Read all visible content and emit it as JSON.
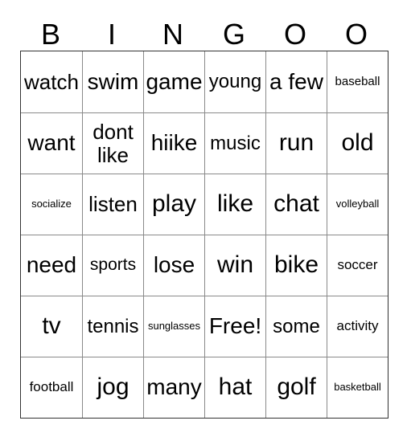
{
  "card": {
    "header_letters": [
      "B",
      "I",
      "N",
      "G",
      "O",
      "O"
    ],
    "columns": 6,
    "rows": 6,
    "colors": {
      "background": "#ffffff",
      "text": "#000000",
      "grid_line": "#8a8a8a",
      "outer_border": "#333333"
    },
    "cells": [
      [
        {
          "text": "watch",
          "size": "fs-l"
        },
        {
          "text": "swim",
          "size": "fs-xl"
        },
        {
          "text": "game",
          "size": "fs-xl"
        },
        {
          "text": "young",
          "size": "fs-ml"
        },
        {
          "text": "a few",
          "size": "fs-xl"
        },
        {
          "text": "baseball",
          "size": "fs-s"
        }
      ],
      [
        {
          "text": "want",
          "size": "fs-xl"
        },
        {
          "text": "dont like",
          "size": "fs-l"
        },
        {
          "text": "hiike",
          "size": "fs-xl"
        },
        {
          "text": "music",
          "size": "fs-ml"
        },
        {
          "text": "run",
          "size": "fs-xxl"
        },
        {
          "text": "old",
          "size": "fs-xxl"
        }
      ],
      [
        {
          "text": "socialize",
          "size": "fs-xs"
        },
        {
          "text": "listen",
          "size": "fs-l"
        },
        {
          "text": "play",
          "size": "fs-xxl"
        },
        {
          "text": "like",
          "size": "fs-xxl"
        },
        {
          "text": "chat",
          "size": "fs-xxl"
        },
        {
          "text": "volleyball",
          "size": "fs-xs"
        }
      ],
      [
        {
          "text": "need",
          "size": "fs-xl"
        },
        {
          "text": "sports",
          "size": "fs-m"
        },
        {
          "text": "lose",
          "size": "fs-xl"
        },
        {
          "text": "win",
          "size": "fs-xxl"
        },
        {
          "text": "bike",
          "size": "fs-xxl"
        },
        {
          "text": "soccer",
          "size": "fs-sm"
        }
      ],
      [
        {
          "text": "tv",
          "size": "fs-xxl"
        },
        {
          "text": "tennis",
          "size": "fs-ml"
        },
        {
          "text": "sunglasses",
          "size": "fs-xs"
        },
        {
          "text": "Free!",
          "size": "fs-xl"
        },
        {
          "text": "some",
          "size": "fs-ml"
        },
        {
          "text": "activity",
          "size": "fs-sm"
        }
      ],
      [
        {
          "text": "football",
          "size": "fs-sm"
        },
        {
          "text": "jog",
          "size": "fs-xxl"
        },
        {
          "text": "many",
          "size": "fs-xl"
        },
        {
          "text": "hat",
          "size": "fs-xxl"
        },
        {
          "text": "golf",
          "size": "fs-xxl"
        },
        {
          "text": "basketball",
          "size": "fs-xs"
        }
      ]
    ]
  }
}
